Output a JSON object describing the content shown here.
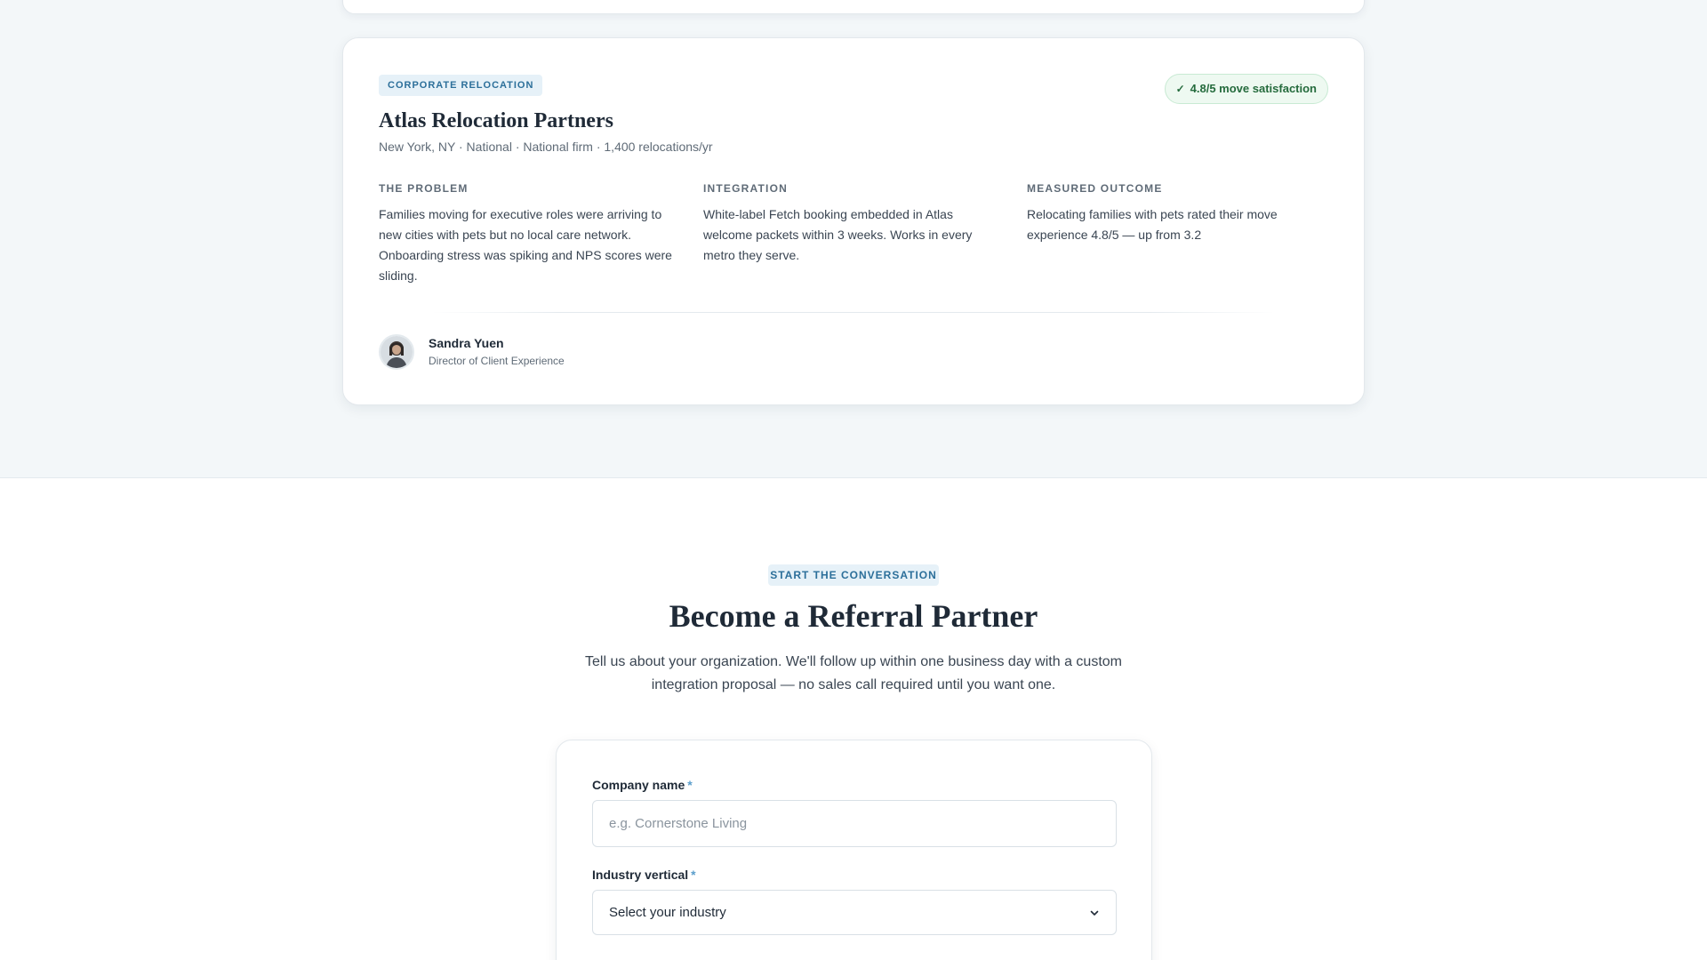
{
  "case_study": {
    "category": "CORPORATE RELOCATION",
    "badge": "4.8/5 move satisfaction",
    "company": "Atlas Relocation Partners",
    "meta": "New York, NY · National · National firm · 1,400 relocations/yr",
    "problem": {
      "heading": "THE PROBLEM",
      "text": "Families moving for executive roles were arriving to new cities with pets but no local care network. Onboarding stress was spiking and NPS scores were sliding."
    },
    "integration": {
      "heading": "INTEGRATION",
      "text": "White-label Fetch booking embedded in Atlas welcome packets within 3 weeks. Works in every metro they serve."
    },
    "outcome": {
      "heading": "MEASURED OUTCOME",
      "text": "Relocating families with pets rated their move experience 4.8/5 — up from 3.2"
    },
    "person": {
      "name": "Sandra Yuen",
      "role": "Director of Client Experience"
    }
  },
  "cta": {
    "tag": "START THE CONVERSATION",
    "title": "Become a Referral Partner",
    "description": "Tell us about your organization. We'll follow up within one business day with a custom integration proposal — no sales call required until you want one."
  },
  "form": {
    "company_label": "Company name",
    "company_placeholder": "e.g. Cornerstone Living",
    "industry_label": "Industry vertical",
    "industry_value": "Select your industry",
    "required_mark": "*"
  },
  "colors": {
    "accent": "#2c6f9a",
    "badge_green": "#256b3d",
    "background": "#f3f7f9"
  },
  "icons": {
    "badge": "check-icon",
    "select": "chevron-down-icon"
  }
}
